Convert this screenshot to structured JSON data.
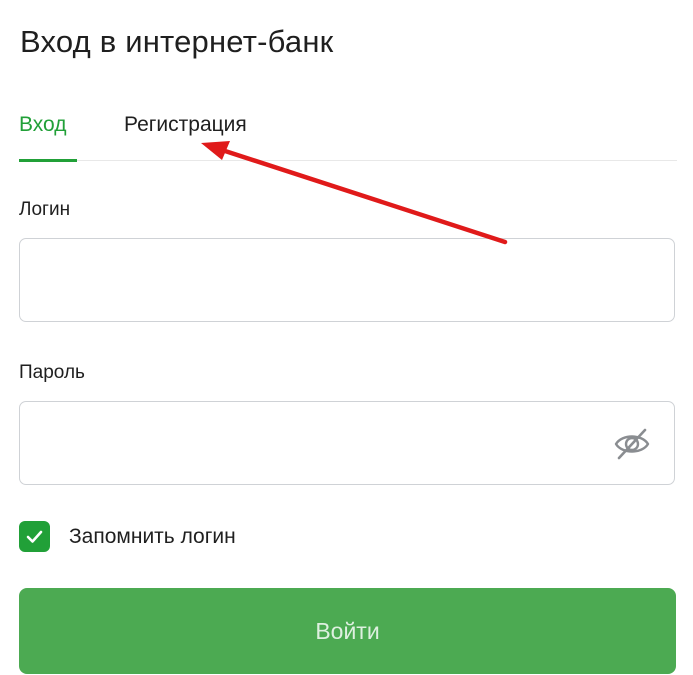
{
  "page": {
    "title": "Вход в интернет-банк"
  },
  "tabs": [
    {
      "label": "Вход",
      "active": true
    },
    {
      "label": "Регистрация",
      "active": false
    }
  ],
  "form": {
    "login_label": "Логин",
    "login_value": "",
    "password_label": "Пароль",
    "password_value": "",
    "password_toggle_icon": "eye-crossed-icon",
    "remember_label": "Запомнить логин",
    "remember_checked": true,
    "submit_label": "Войти"
  },
  "colors": {
    "accent": "#21a038",
    "button": "#4caa52",
    "annotation_arrow": "#e01a1a",
    "input_border": "#cfd2d6"
  },
  "annotation": {
    "icon": "red-arrow-icon",
    "points_to": "Регистрация"
  }
}
